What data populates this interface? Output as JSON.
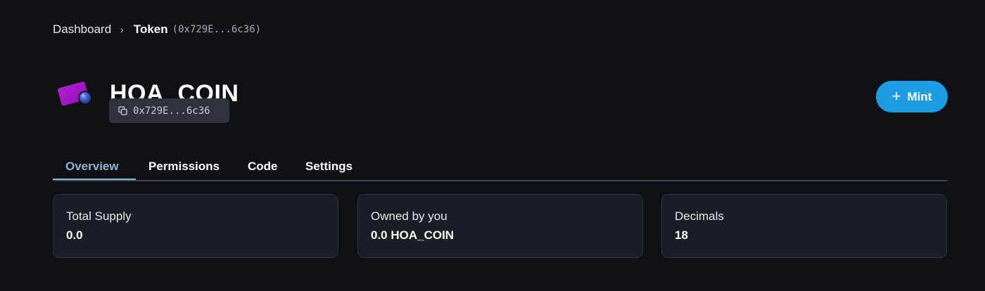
{
  "breadcrumb": {
    "root": "Dashboard",
    "separator": "›",
    "current": "Token",
    "address": "(0x729E...6c36)"
  },
  "token": {
    "name": "HOA_COIN",
    "address_short": "0x729E...6c36",
    "logo_icon": "purple-card-icon",
    "copy_icon": "copy-icon"
  },
  "actions": {
    "mint_label": "Mint",
    "mint_icon": "plus-icon"
  },
  "tabs": [
    {
      "label": "Overview",
      "active": true
    },
    {
      "label": "Permissions",
      "active": false
    },
    {
      "label": "Code",
      "active": false
    },
    {
      "label": "Settings",
      "active": false
    }
  ],
  "stats": [
    {
      "label": "Total Supply",
      "value": "0.0"
    },
    {
      "label": "Owned by you",
      "value": "0.0 HOA_COIN"
    },
    {
      "label": "Decimals",
      "value": "18"
    }
  ],
  "colors": {
    "background": "#0f1116",
    "accent": "#1d9be3",
    "active_tab": "#8fb5d2",
    "card": "#1a1e25"
  }
}
